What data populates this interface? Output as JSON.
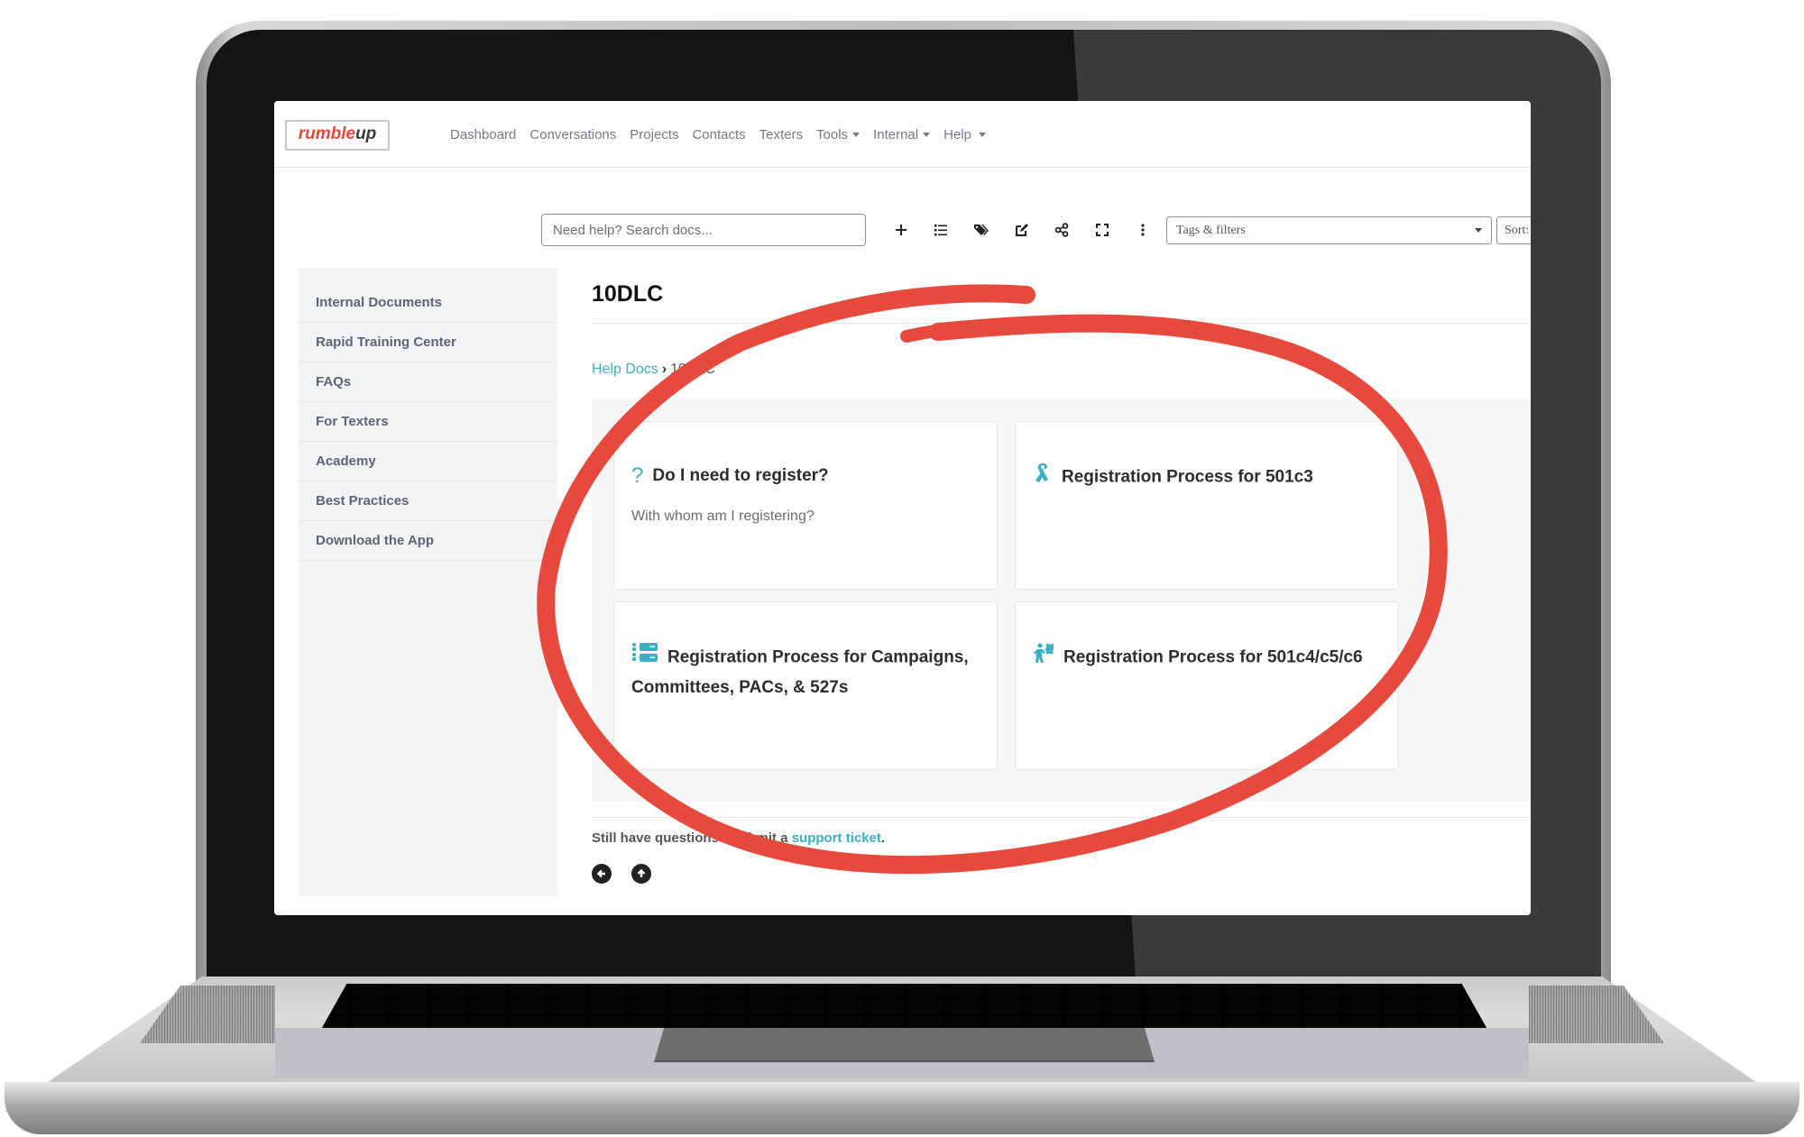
{
  "brand": {
    "logo_part1": "rumble",
    "logo_part2": "up",
    "accent": "#3aaec5",
    "logo_red": "#e5483d"
  },
  "nav": {
    "items": [
      {
        "label": "Dashboard",
        "dropdown": false
      },
      {
        "label": "Conversations",
        "dropdown": false
      },
      {
        "label": "Projects",
        "dropdown": false
      },
      {
        "label": "Contacts",
        "dropdown": false
      },
      {
        "label": "Texters",
        "dropdown": false
      },
      {
        "label": "Tools",
        "dropdown": true
      },
      {
        "label": "Internal",
        "dropdown": true
      },
      {
        "label": "Help",
        "dropdown": true
      }
    ]
  },
  "toolbar": {
    "search_placeholder": "Need help? Search docs...",
    "icons": [
      "plus-icon",
      "list-icon",
      "tags-icon",
      "edit-icon",
      "share-icon",
      "fullscreen-icon",
      "more-vertical-icon"
    ],
    "tags_filter_label": "Tags & filters",
    "sort_label": "Sort:"
  },
  "sidebar": {
    "items": [
      {
        "label": "Internal Documents"
      },
      {
        "label": "Rapid Training Center"
      },
      {
        "label": "FAQs"
      },
      {
        "label": "For Texters"
      },
      {
        "label": "Academy"
      },
      {
        "label": "Best Practices"
      },
      {
        "label": "Download the App"
      }
    ]
  },
  "main": {
    "title": "10DLC",
    "breadcrumb": {
      "parent": "Help Docs",
      "separator": "›",
      "current": "10DLC"
    },
    "cards": [
      {
        "icon": "question-icon",
        "title": "Do I need to register?",
        "description": "With whom am I registering?"
      },
      {
        "icon": "ribbon-icon",
        "title": "Registration Process for 501c3",
        "description": ""
      },
      {
        "icon": "list-users-icon",
        "title": "Registration Process for Campaigns, Committees, PACs, & 527s",
        "description": ""
      },
      {
        "icon": "person-puzzle-icon",
        "title": "Registration Process for 501c4/c5/c6",
        "description": ""
      }
    ],
    "footer": {
      "text_before": "Still have questions? Submit a ",
      "link": "support ticket",
      "text_after": ".",
      "buttons": [
        "back-arrow-icon",
        "up-arrow-icon"
      ]
    }
  },
  "annotation": {
    "type": "hand-drawn circle",
    "color": "#e64a3d"
  }
}
